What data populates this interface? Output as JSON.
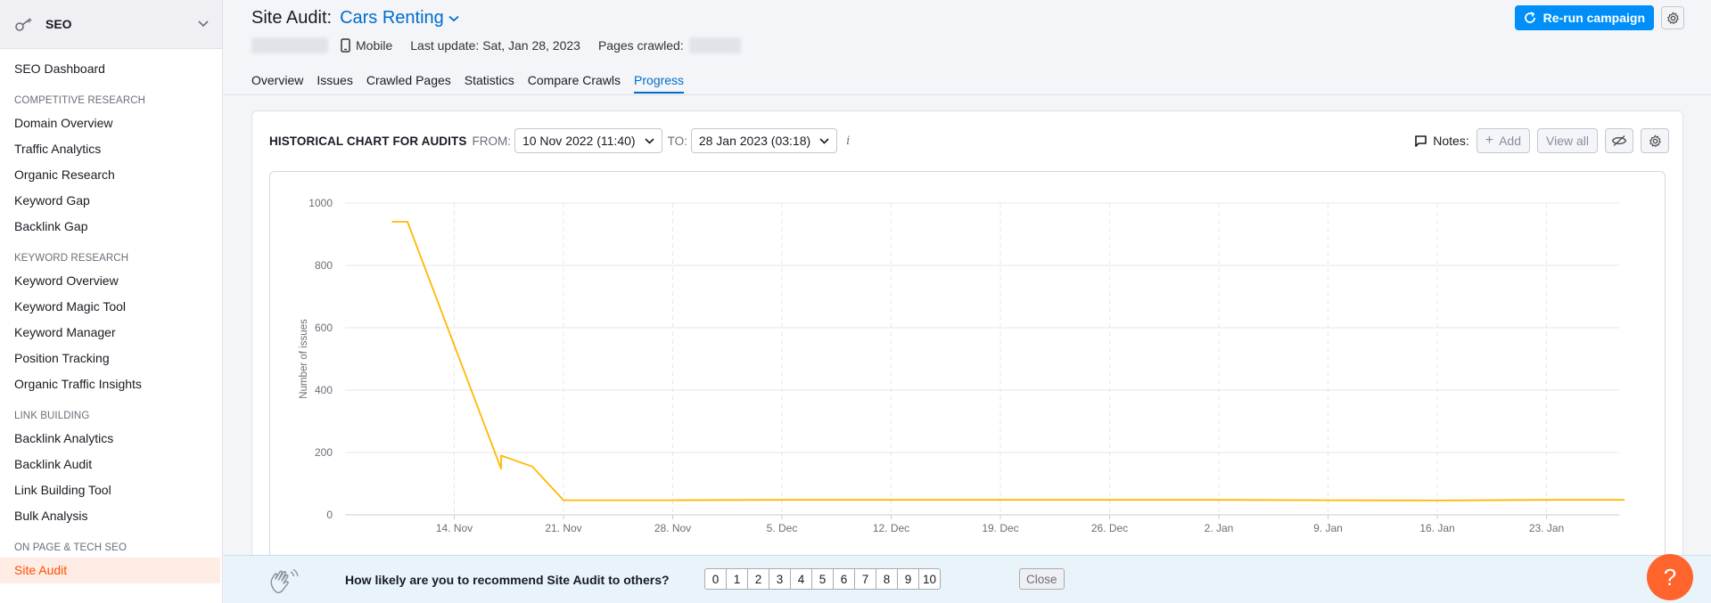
{
  "sidebar": {
    "title": "SEO",
    "dashboard": "SEO Dashboard",
    "sections": [
      {
        "title": "COMPETITIVE RESEARCH",
        "items": [
          "Domain Overview",
          "Traffic Analytics",
          "Organic Research",
          "Keyword Gap",
          "Backlink Gap"
        ]
      },
      {
        "title": "KEYWORD RESEARCH",
        "items": [
          "Keyword Overview",
          "Keyword Magic Tool",
          "Keyword Manager",
          "Position Tracking",
          "Organic Traffic Insights"
        ]
      },
      {
        "title": "LINK BUILDING",
        "items": [
          "Backlink Analytics",
          "Backlink Audit",
          "Link Building Tool",
          "Bulk Analysis"
        ]
      },
      {
        "title": "ON PAGE & TECH SEO",
        "items": [
          "Site Audit"
        ]
      }
    ],
    "active_item": "Site Audit"
  },
  "header": {
    "title_prefix": "Site Audit:",
    "project": "Cars Renting",
    "device": "Mobile",
    "last_update": "Last update: Sat, Jan 28, 2023",
    "pages_crawled": "Pages crawled:",
    "rerun_label": "Re-run campaign",
    "tabs": [
      "Overview",
      "Issues",
      "Crawled Pages",
      "Statistics",
      "Compare Crawls",
      "Progress"
    ],
    "active_tab": "Progress"
  },
  "card": {
    "title": "HISTORICAL CHART FOR AUDITS",
    "from_label": "FROM:",
    "from_value": "10 Nov 2022 (11:40)",
    "to_label": "TO:",
    "to_value": "28 Jan 2023 (03:18)",
    "info": "i",
    "notes_label": "Notes:",
    "add_label": "Add",
    "view_all_label": "View all"
  },
  "chart_data": {
    "type": "line",
    "title": "",
    "xlabel": "",
    "ylabel": "Number of issues",
    "ylim": [
      0,
      1000
    ],
    "yticks": [
      0,
      200,
      400,
      600,
      800,
      1000
    ],
    "xtick_labels": [
      "14. Nov",
      "21. Nov",
      "28. Nov",
      "5. Dec",
      "12. Dec",
      "19. Dec",
      "26. Dec",
      "2. Jan",
      "9. Jan",
      "16. Jan",
      "23. Jan"
    ],
    "xtick_dates": [
      "2022-11-14",
      "2022-11-21",
      "2022-11-28",
      "2022-12-05",
      "2022-12-12",
      "2022-12-19",
      "2022-12-26",
      "2023-01-02",
      "2023-01-09",
      "2023-01-16",
      "2023-01-23"
    ],
    "x_range": [
      "2022-11-10",
      "2023-01-28"
    ],
    "grid": true,
    "color": "#ffb800",
    "series": [
      {
        "x": [
          "2022-11-10",
          "2022-11-11",
          "2022-11-17",
          "2022-11-17",
          "2022-11-19",
          "2022-11-21",
          "2022-11-28",
          "2022-12-05",
          "2022-12-12",
          "2022-12-19",
          "2022-12-26",
          "2023-01-02",
          "2023-01-09",
          "2023-01-16",
          "2023-01-23",
          "2023-01-28"
        ],
        "values": [
          940,
          940,
          148,
          190,
          155,
          47,
          47,
          48,
          48,
          48,
          48,
          48,
          47,
          46,
          48,
          48
        ]
      }
    ]
  },
  "feedback": {
    "question": "How likely are you to recommend Site Audit to others?",
    "scale": [
      "0",
      "1",
      "2",
      "3",
      "4",
      "5",
      "6",
      "7",
      "8",
      "9",
      "10"
    ],
    "close_label": "Close"
  },
  "help": {
    "label": "?"
  }
}
